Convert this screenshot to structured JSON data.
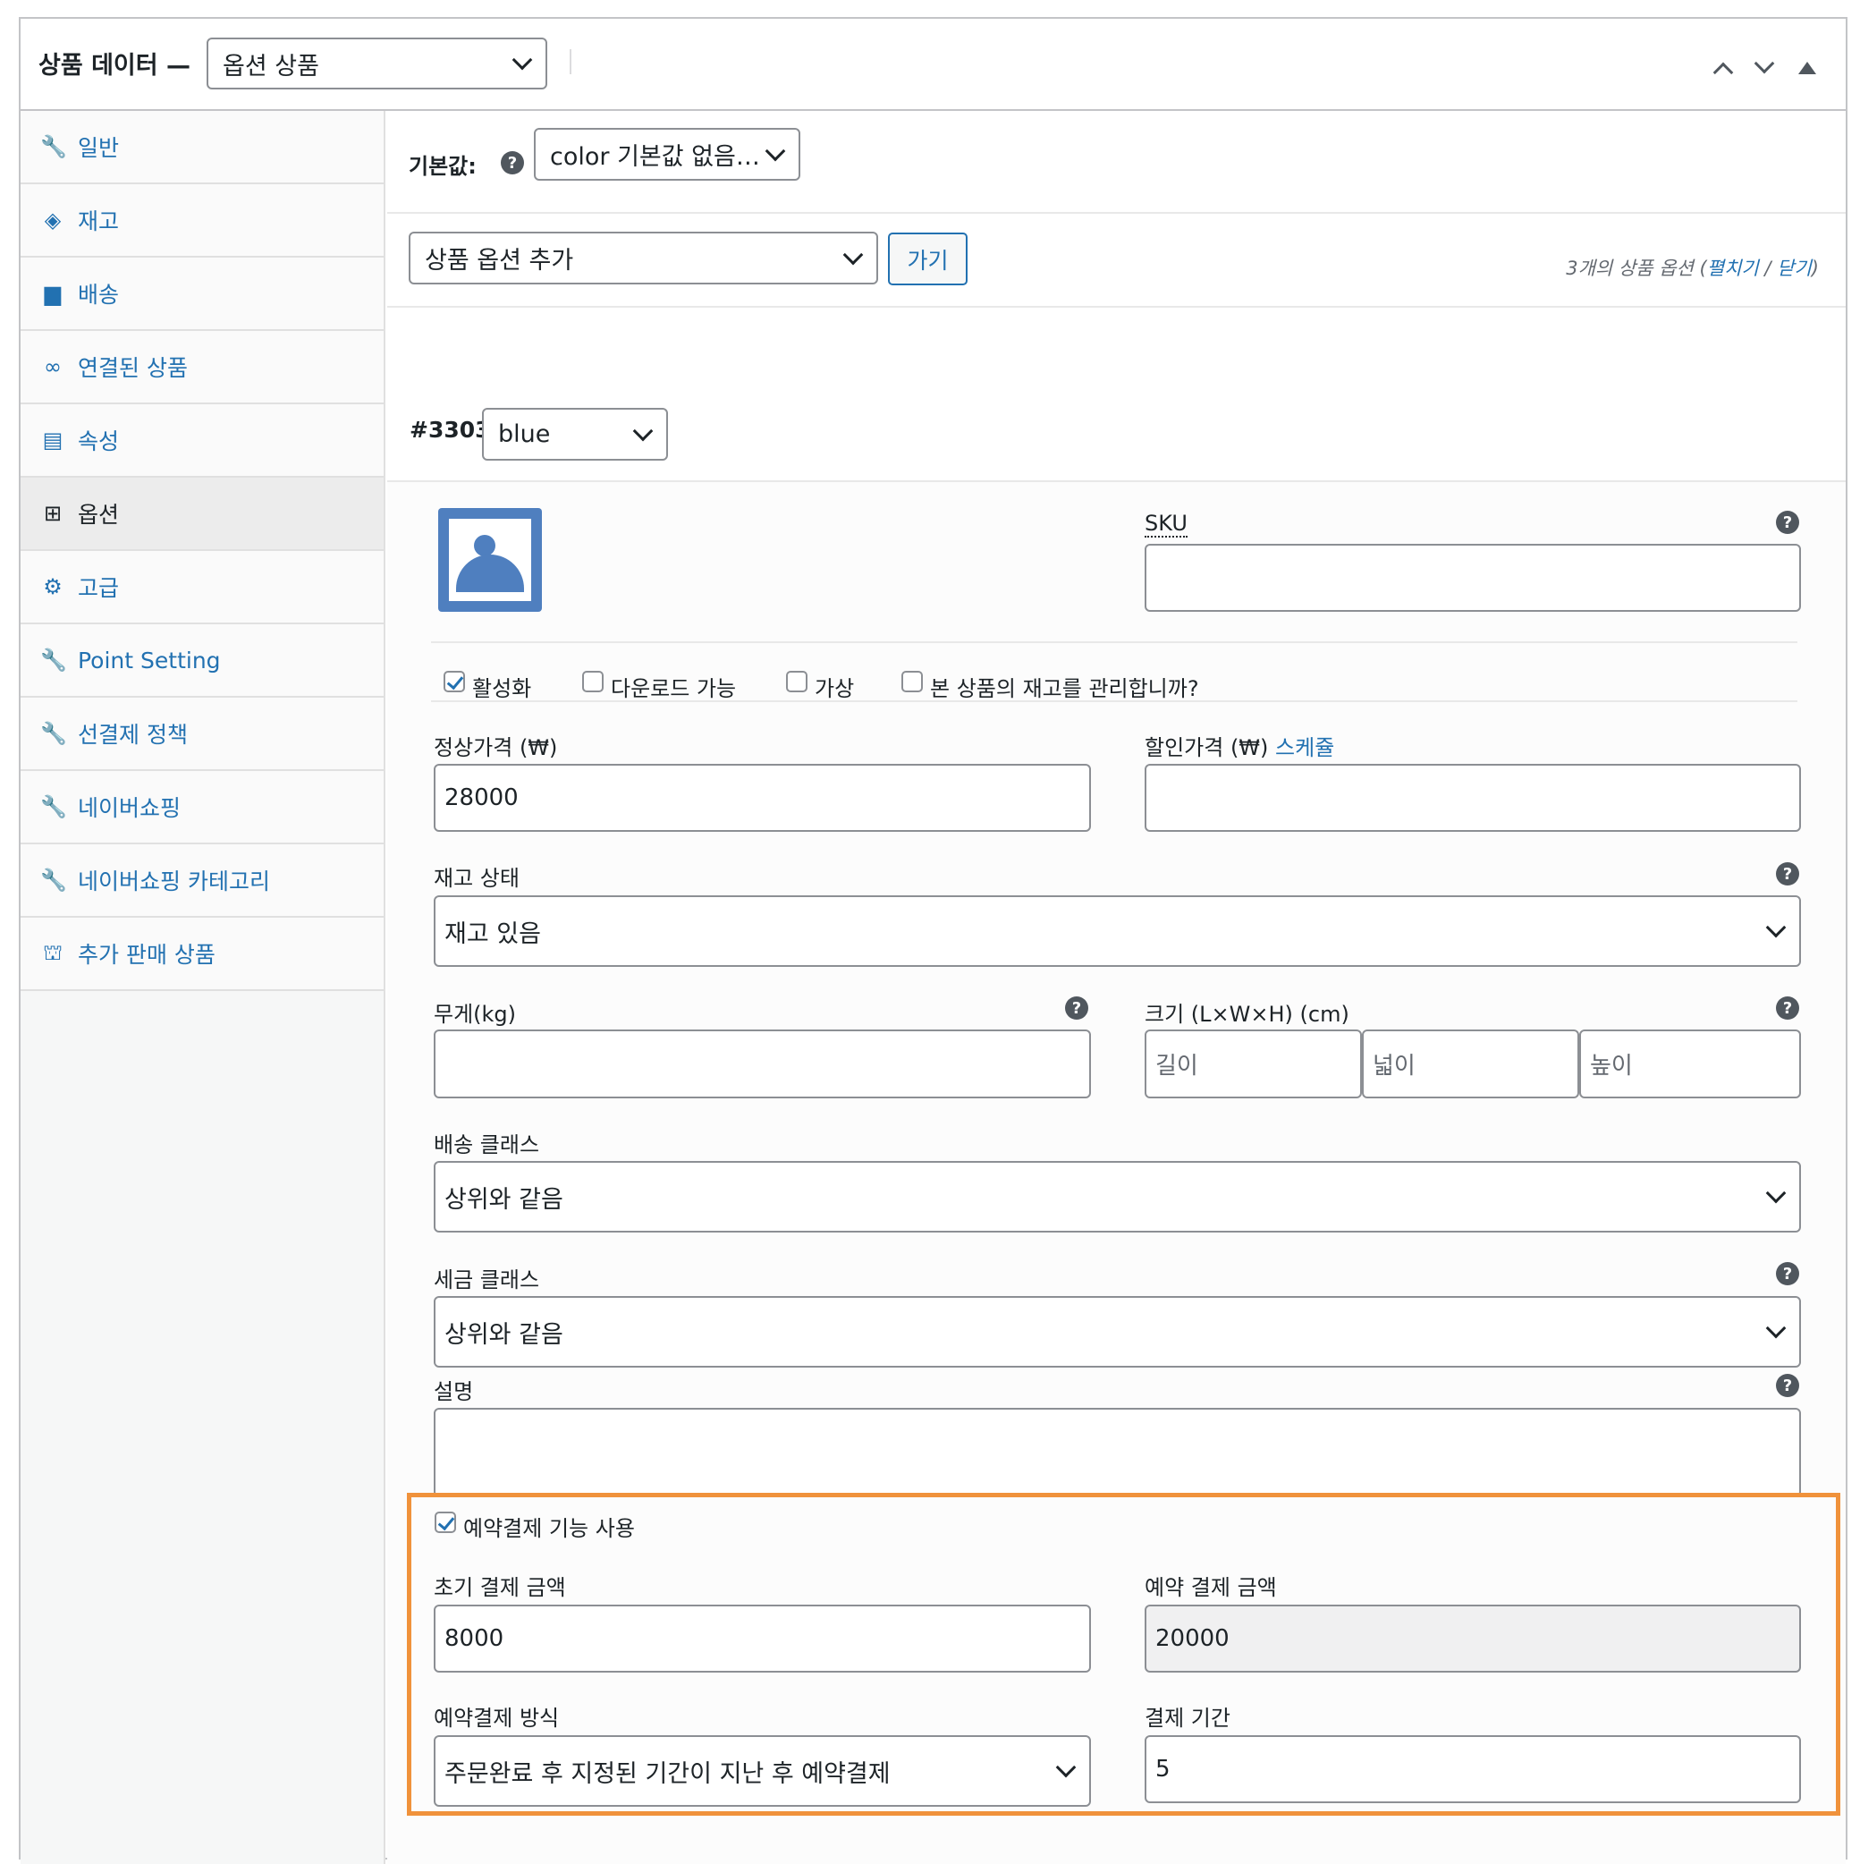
{
  "header": {
    "title": "상품 데이터 —",
    "type_value": "옵션 상품"
  },
  "tabs": [
    {
      "label": "일반",
      "icon": "wrench-icon"
    },
    {
      "label": "재고",
      "icon": "tag-icon"
    },
    {
      "label": "배송",
      "icon": "truck-icon"
    },
    {
      "label": "연결된 상품",
      "icon": "link-icon"
    },
    {
      "label": "속성",
      "icon": "list-icon"
    },
    {
      "label": "옵션",
      "icon": "grid-icon"
    },
    {
      "label": "고급",
      "icon": "gear-icon"
    },
    {
      "label": "Point Setting",
      "icon": "wrench-icon"
    },
    {
      "label": "선결제 정책",
      "icon": "wrench-icon"
    },
    {
      "label": "네이버쇼핑",
      "icon": "wrench-icon"
    },
    {
      "label": "네이버쇼핑 카테고리",
      "icon": "wrench-icon"
    },
    {
      "label": "추가 판매 상품",
      "icon": "bag-icon"
    }
  ],
  "defaults": {
    "label": "기본값:",
    "value": "color 기본값 없음…"
  },
  "bulk": {
    "value": "상품 옵션 추가",
    "go": "가기",
    "count": "3개의 상품 옵션 (",
    "expand": "펼치기",
    "sep": " / ",
    "close": "닫기",
    "end": ")"
  },
  "variation": {
    "id": "#3303",
    "attr": "blue",
    "sku_label": "SKU",
    "sku_value": "",
    "cb_enabled": "활성화",
    "cb_download": "다운로드 가능",
    "cb_virtual": "가상",
    "cb_manage": "본 상품의 재고를 관리합니까?",
    "reg_price_label": "정상가격 (₩)",
    "reg_price": "28000",
    "sale_price_label": "할인가격 (₩)",
    "schedule": "스케쥴",
    "stock_label": "재고 상태",
    "stock_value": "재고 있음",
    "weight_label": "무게(kg)",
    "dims_label": "크기 (L×W×H) (cm)",
    "len_ph": "길이",
    "wid_ph": "넓이",
    "hei_ph": "높이",
    "ship_label": "배송 클래스",
    "ship_value": "상위와 같음",
    "tax_label": "세금 클래스",
    "tax_value": "상위와 같음",
    "desc_label": "설명",
    "prepay_cb": "예약결제 기능 사용",
    "init_label": "초기 결제 금액",
    "init_value": "8000",
    "res_label": "예약 결제 금액",
    "res_value": "20000",
    "method_label": "예약결제 방식",
    "method_value": "주문완료 후 지정된 기간이 지난 후 예약결제",
    "period_label": "결제 기간",
    "period_value": "5"
  },
  "colors": {
    "accent": "#2271b1",
    "highlight": "#f0923b"
  }
}
